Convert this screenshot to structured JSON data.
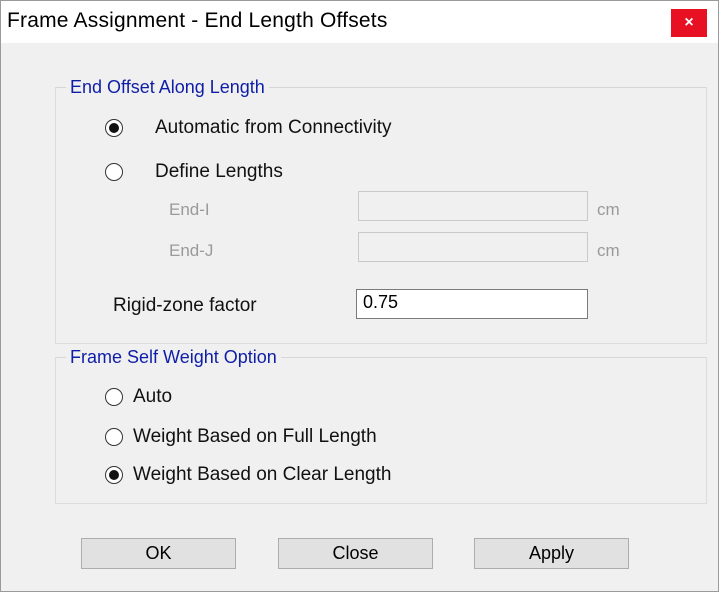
{
  "window": {
    "title": "Frame Assignment - End Length Offsets",
    "close_glyph": "×"
  },
  "end_offset": {
    "legend": "End Offset Along Length",
    "options": [
      {
        "label": "Automatic from Connectivity",
        "selected": true
      },
      {
        "label": "Define Lengths",
        "selected": false
      }
    ],
    "end_i": {
      "label": "End-I",
      "value": "",
      "unit": "cm"
    },
    "end_j": {
      "label": "End-J",
      "value": "",
      "unit": "cm"
    },
    "rigid_zone": {
      "label": "Rigid-zone factor",
      "value": "0.75"
    }
  },
  "self_weight": {
    "legend": "Frame Self Weight Option",
    "options": [
      {
        "label": "Auto",
        "selected": false
      },
      {
        "label": "Weight Based on Full Length",
        "selected": false
      },
      {
        "label": "Weight Based on Clear Length",
        "selected": true
      }
    ]
  },
  "buttons": {
    "ok": "OK",
    "close": "Close",
    "apply": "Apply"
  }
}
